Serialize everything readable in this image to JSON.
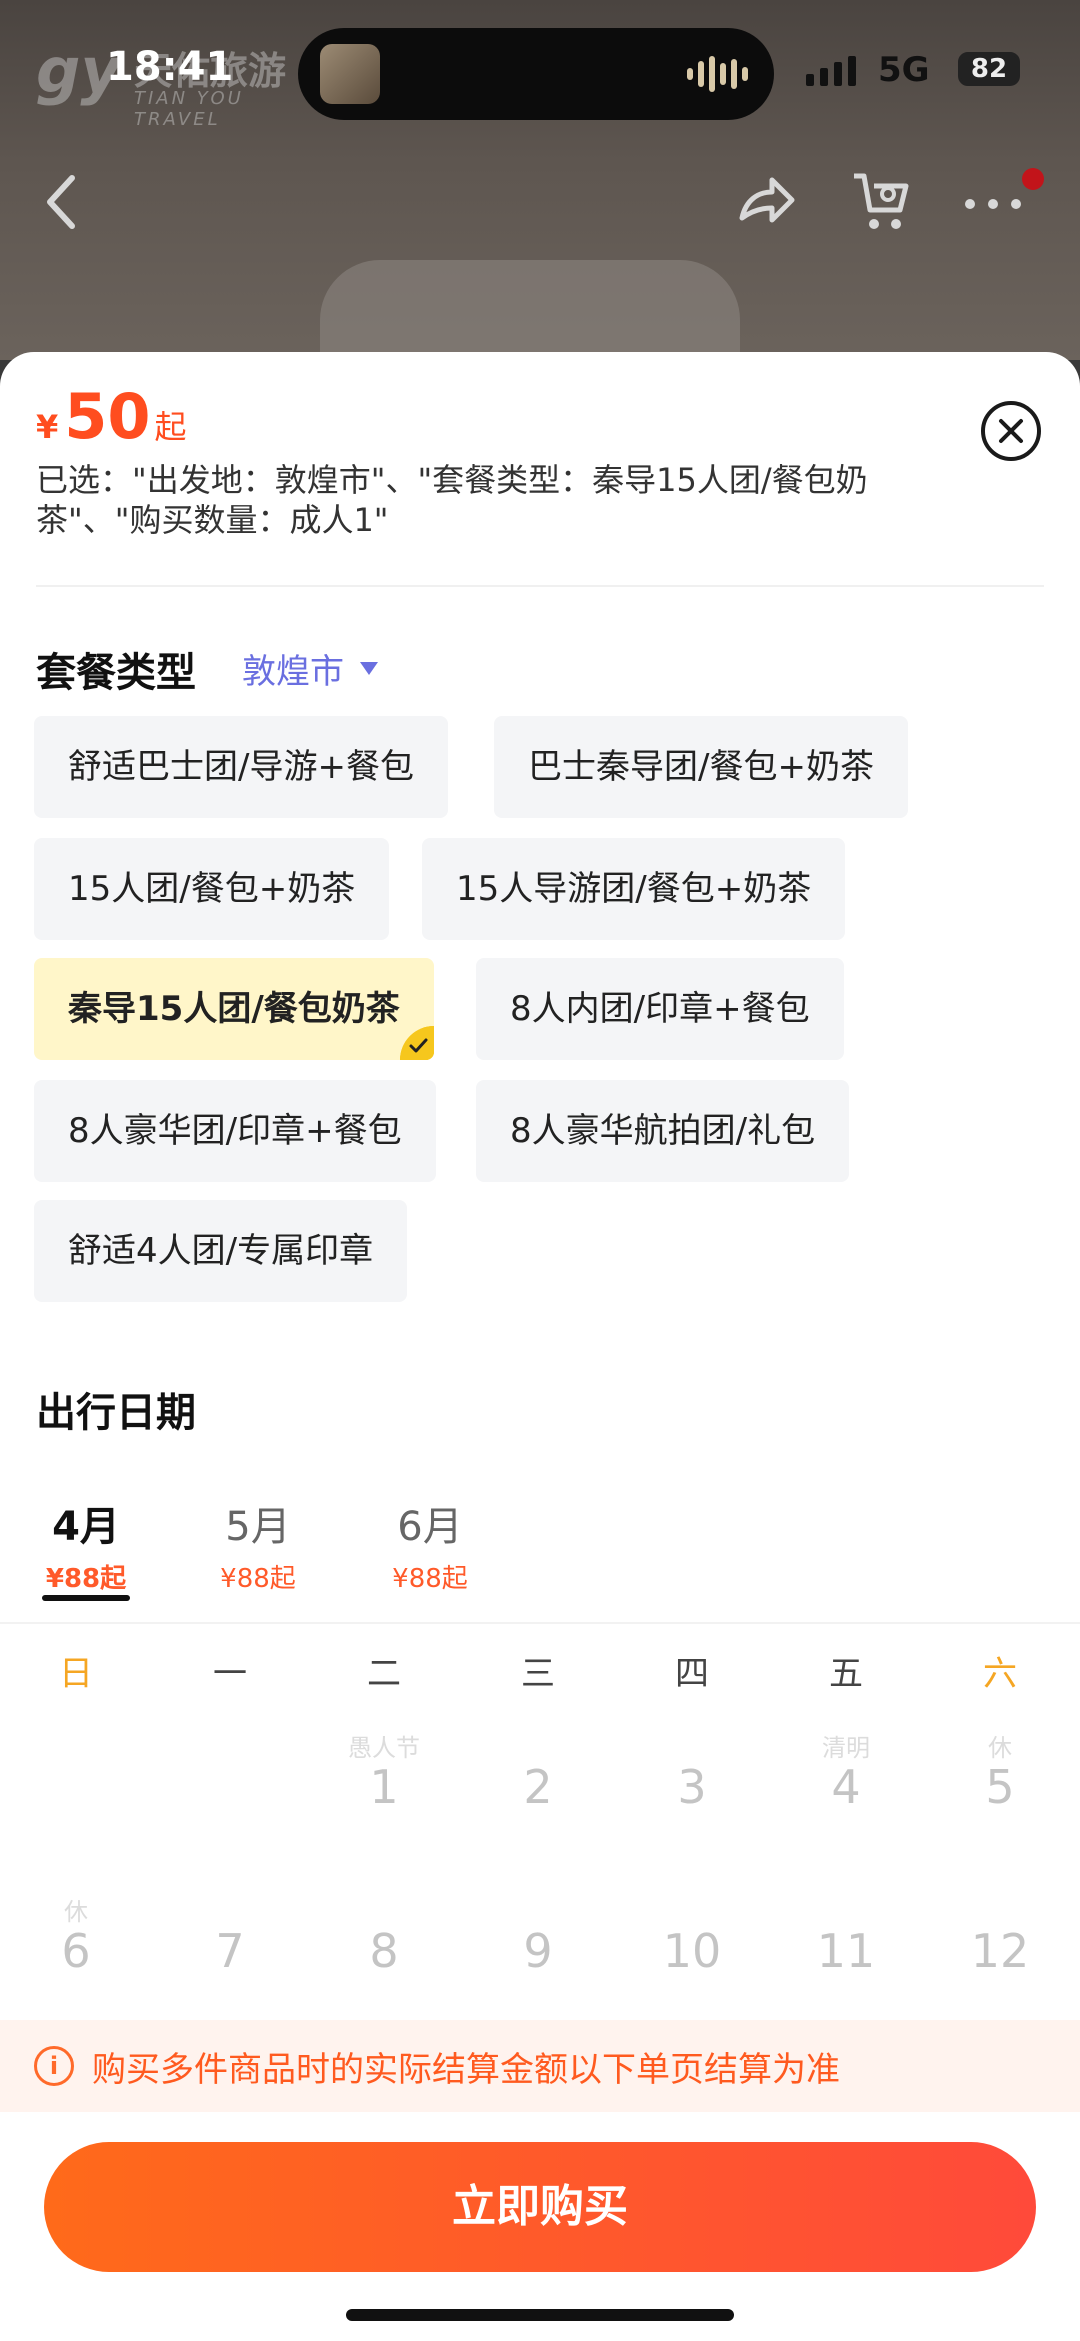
{
  "status_bar": {
    "time": "18:41",
    "network": "5G",
    "battery": "82"
  },
  "brand": {
    "mark": "gy",
    "name_cn": "天佑旅游",
    "name_en": "TIAN YOU TRAVEL"
  },
  "price": {
    "currency": "¥",
    "amount": "50",
    "suffix": "起"
  },
  "selection_summary": "已选：\"出发地：敦煌市\"、\"套餐类型：秦导15人团/餐包奶茶\"、\"购买数量：成人1\"",
  "package": {
    "title": "套餐类型",
    "origin": "敦煌市",
    "options": [
      {
        "label": "舒适巴士团/导游+餐包",
        "selected": false
      },
      {
        "label": "巴士秦导团/餐包+奶茶",
        "selected": false
      },
      {
        "label": "15人团/餐包+奶茶",
        "selected": false
      },
      {
        "label": "15人导游团/餐包+奶茶",
        "selected": false
      },
      {
        "label": "秦导15人团/餐包奶茶",
        "selected": true
      },
      {
        "label": "8人内团/印章+餐包",
        "selected": false
      },
      {
        "label": "8人豪华团/印章+餐包",
        "selected": false
      },
      {
        "label": "8人豪华航拍团/礼包",
        "selected": false
      },
      {
        "label": "舒适4人团/专属印章",
        "selected": false
      }
    ]
  },
  "date": {
    "title": "出行日期",
    "months": [
      {
        "label": "4月",
        "price": "¥88起",
        "active": true
      },
      {
        "label": "5月",
        "price": "¥88起",
        "active": false
      },
      {
        "label": "6月",
        "price": "¥88起",
        "active": false
      }
    ],
    "weekdays": [
      "日",
      "一",
      "二",
      "三",
      "四",
      "五",
      "六"
    ],
    "rows": [
      [
        {
          "day": "",
          "tag": ""
        },
        {
          "day": "",
          "tag": ""
        },
        {
          "day": "1",
          "tag": "愚人节"
        },
        {
          "day": "2",
          "tag": ""
        },
        {
          "day": "3",
          "tag": ""
        },
        {
          "day": "4",
          "tag": "清明"
        },
        {
          "day": "5",
          "tag": "休"
        }
      ],
      [
        {
          "day": "6",
          "tag": "休"
        },
        {
          "day": "7",
          "tag": ""
        },
        {
          "day": "8",
          "tag": ""
        },
        {
          "day": "9",
          "tag": ""
        },
        {
          "day": "10",
          "tag": ""
        },
        {
          "day": "11",
          "tag": ""
        },
        {
          "day": "12",
          "tag": ""
        }
      ]
    ]
  },
  "notice": {
    "icon": "info-icon",
    "text": "购买多件商品时的实际结算金额以下单页结算为准"
  },
  "buy_button": "立即购买",
  "colors": {
    "accent": "#ff4d1f",
    "selected_bg": "#fff6c9",
    "check": "#f6c71d",
    "origin": "#6a6fe0",
    "weekend": "#f5a623"
  }
}
